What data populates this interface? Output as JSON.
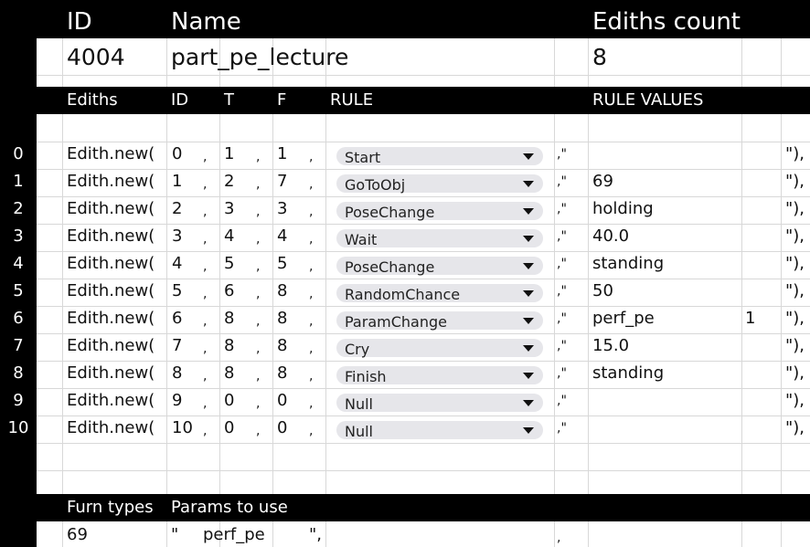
{
  "header": {
    "id_label": "ID",
    "name_label": "Name",
    "count_label": "Ediths count",
    "id_value": "4004",
    "name_value": "part_pe_lecture",
    "count_value": "8"
  },
  "columns": {
    "ediths": "Ediths",
    "id": "ID",
    "t": "T",
    "f": "F",
    "rule": "RULE",
    "rule_values": "RULE VALUES"
  },
  "rows": [
    {
      "num": "0",
      "prefix": "Edith.new(",
      "id": "0",
      "t": "1",
      "f": "1",
      "rule": "Start",
      "value": "",
      "extra": "",
      "tail": "\"),"
    },
    {
      "num": "1",
      "prefix": "Edith.new(",
      "id": "1",
      "t": "2",
      "f": "7",
      "rule": "GoToObj",
      "value": "69",
      "extra": "",
      "tail": "\"),"
    },
    {
      "num": "2",
      "prefix": "Edith.new(",
      "id": "2",
      "t": "3",
      "f": "3",
      "rule": "PoseChange",
      "value": "holding",
      "extra": "",
      "tail": "\"),"
    },
    {
      "num": "3",
      "prefix": "Edith.new(",
      "id": "3",
      "t": "4",
      "f": "4",
      "rule": "Wait",
      "value": "40.0",
      "extra": "",
      "tail": "\"),"
    },
    {
      "num": "4",
      "prefix": "Edith.new(",
      "id": "4",
      "t": "5",
      "f": "5",
      "rule": "PoseChange",
      "value": "standing",
      "extra": "",
      "tail": "\"),"
    },
    {
      "num": "5",
      "prefix": "Edith.new(",
      "id": "5",
      "t": "6",
      "f": "8",
      "rule": "RandomChance",
      "value": "50",
      "extra": "",
      "tail": "\"),"
    },
    {
      "num": "6",
      "prefix": "Edith.new(",
      "id": "6",
      "t": "8",
      "f": "8",
      "rule": "ParamChange",
      "value": "perf_pe",
      "extra": "1",
      "tail": "\"),"
    },
    {
      "num": "7",
      "prefix": "Edith.new(",
      "id": "7",
      "t": "8",
      "f": "8",
      "rule": "Cry",
      "value": "15.0",
      "extra": "",
      "tail": "\"),"
    },
    {
      "num": "8",
      "prefix": "Edith.new(",
      "id": "8",
      "t": "8",
      "f": "8",
      "rule": "Finish",
      "value": "standing",
      "extra": "",
      "tail": "\"),"
    },
    {
      "num": "9",
      "prefix": "Edith.new(",
      "id": "9",
      "t": "0",
      "f": "0",
      "rule": "Null",
      "value": "",
      "extra": "",
      "tail": "\"),"
    },
    {
      "num": "10",
      "prefix": "Edith.new(",
      "id": "10",
      "t": "0",
      "f": "0",
      "rule": "Null",
      "value": "",
      "extra": "",
      "tail": "\"),"
    }
  ],
  "separators": {
    "comma": ",",
    "quote_open": ",\""
  },
  "footer": {
    "furn_types_label": "Furn types",
    "params_label": "Params to use",
    "furn_value": "69",
    "quote_open": "\"",
    "param_value": "perf_pe",
    "quote_close": "\",",
    "trailing_comma": ","
  }
}
